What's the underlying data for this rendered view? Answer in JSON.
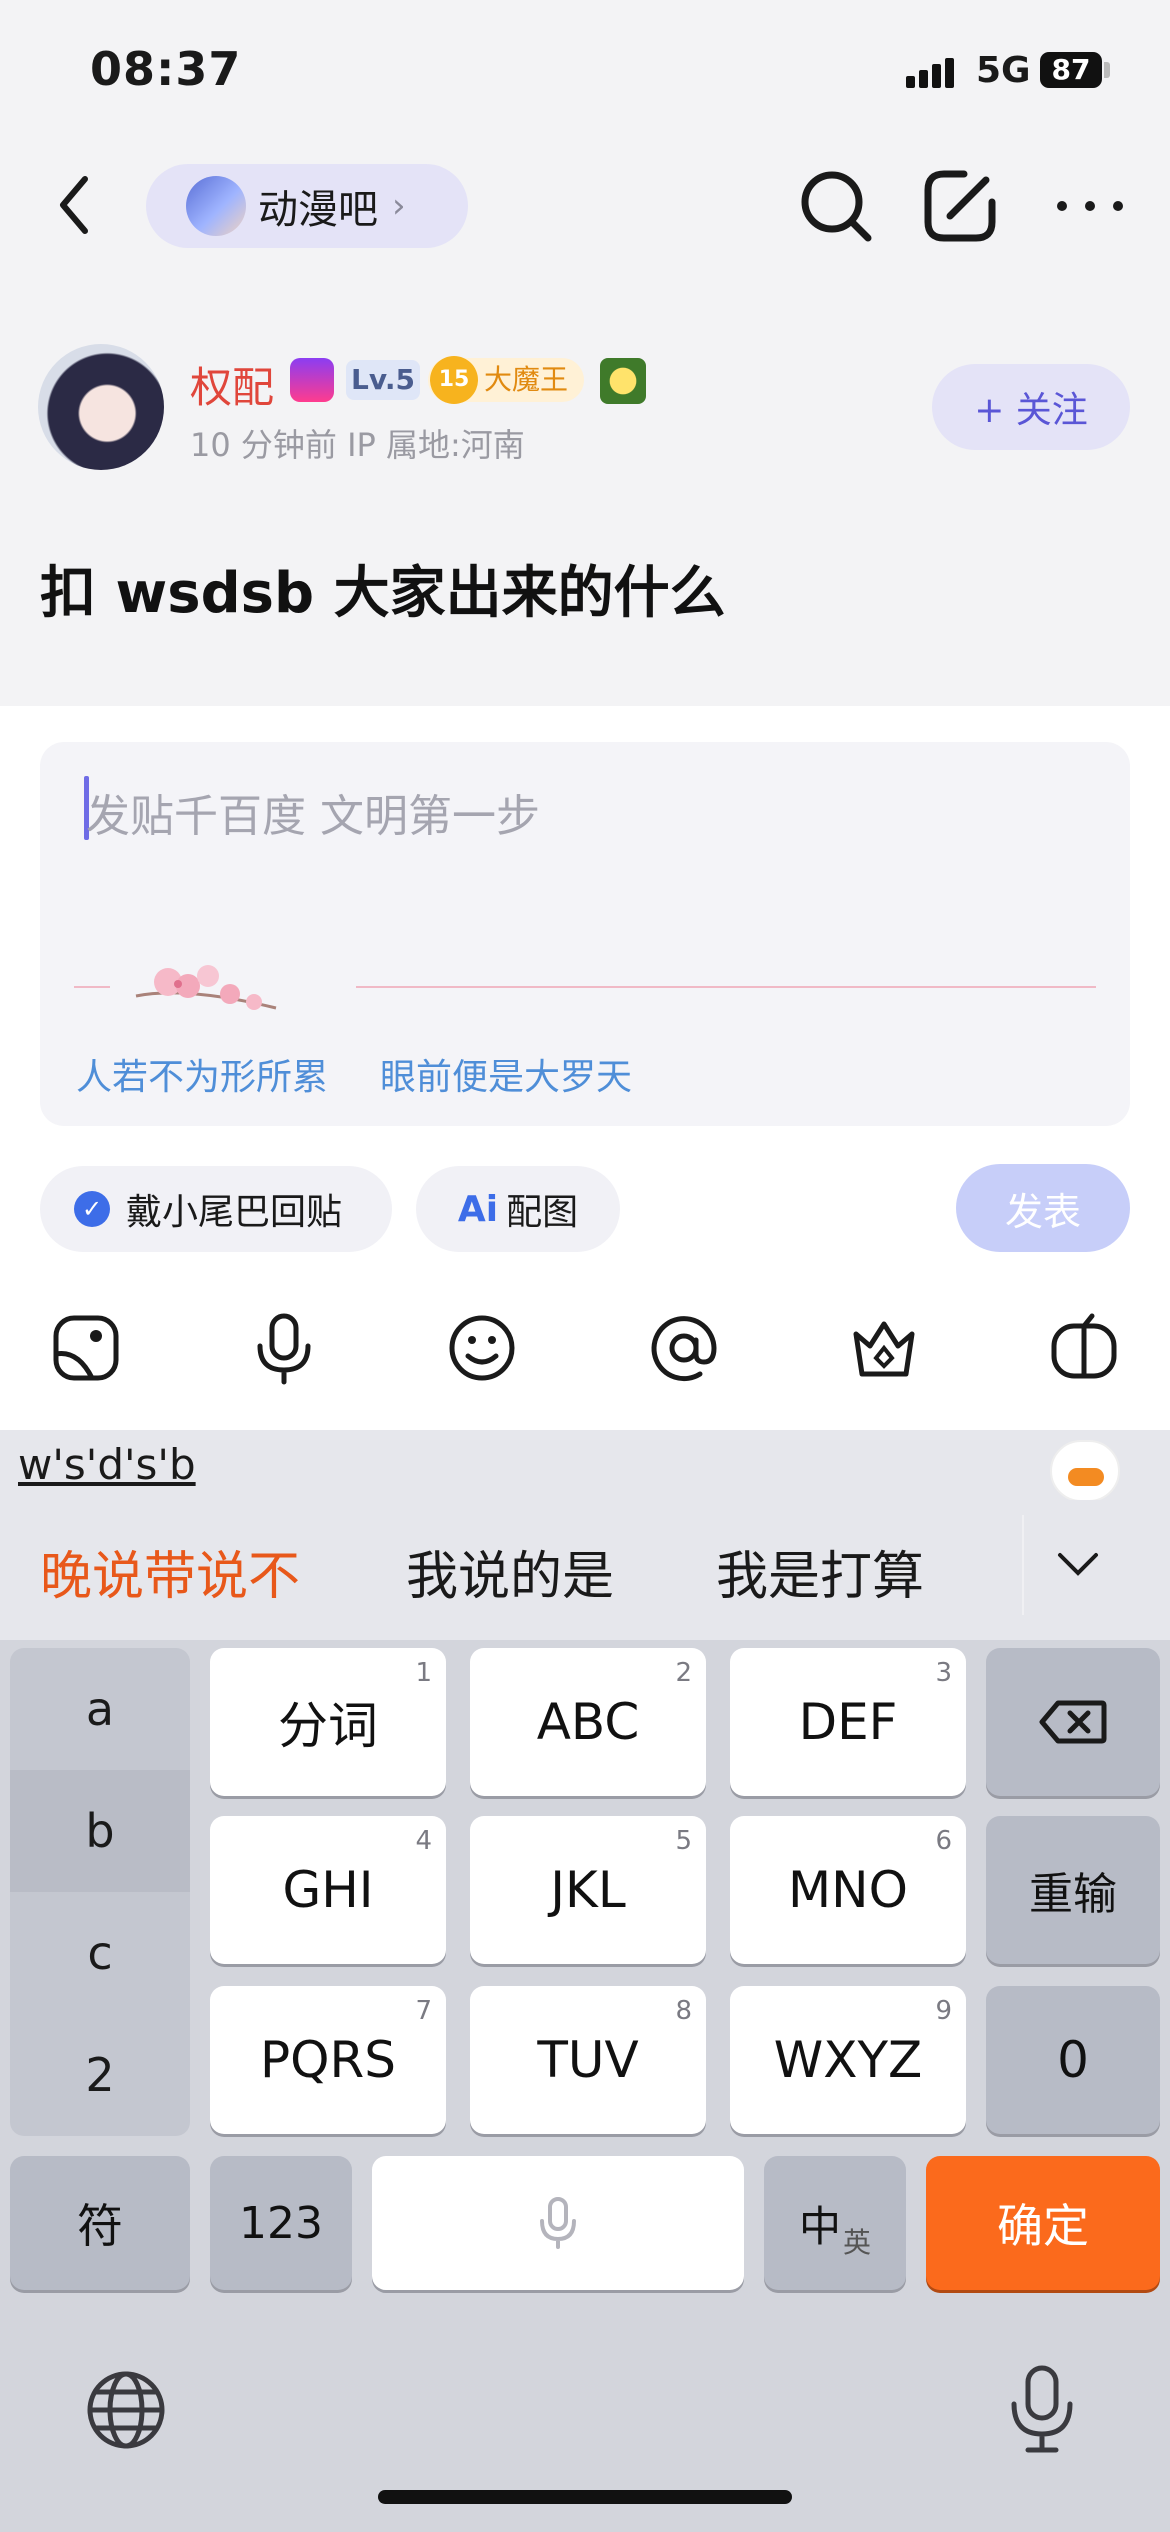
{
  "status_bar": {
    "time": "08:37",
    "network": "5G",
    "battery": "87"
  },
  "header": {
    "forum_name": "动漫吧",
    "icons": [
      "back-icon",
      "search-icon",
      "edit-icon",
      "more-icon"
    ]
  },
  "post": {
    "author": "权配",
    "level": "Lv.5",
    "rank_number": "15",
    "rank_title": "大魔王",
    "meta": "10 分钟前   IP 属地:河南",
    "follow_label": "+ 关注",
    "title": "扣 wsdsb 大家出来的什么"
  },
  "reply": {
    "placeholder": "发贴千百度 文明第一步",
    "tail_text_1": "人若不为形所累",
    "tail_text_2": "眼前便是大罗天",
    "tail_toggle_label": "戴小尾巴回贴",
    "image_button_label": "配图",
    "image_button_mark": "Ai",
    "publish_label": "发表",
    "toolbar_icons": [
      "sticker-icon",
      "microphone-icon",
      "emoji-icon",
      "mention-icon",
      "crown-icon",
      "gift-icon"
    ]
  },
  "keyboard": {
    "pinyin": "w's'd's'b",
    "candidates": [
      "晚说带说不",
      "我说的是",
      "我是打算"
    ],
    "side_column": [
      "a",
      "b",
      "c",
      "2"
    ],
    "keys": [
      {
        "label": "分词",
        "num": "1"
      },
      {
        "label": "ABC",
        "num": "2"
      },
      {
        "label": "DEF",
        "num": "3"
      },
      {
        "label": "GHI",
        "num": "4"
      },
      {
        "label": "JKL",
        "num": "5"
      },
      {
        "label": "MNO",
        "num": "6"
      },
      {
        "label": "PQRS",
        "num": "7"
      },
      {
        "label": "TUV",
        "num": "8"
      },
      {
        "label": "WXYZ",
        "num": "9"
      }
    ],
    "reset_label": "重输",
    "zero_label": "0",
    "symbol_label": "符",
    "numeric_label": "123",
    "lang_main": "中",
    "lang_alt": "英",
    "confirm_label": "确定",
    "colors": {
      "confirm": "#fb6a1c",
      "candidate_highlight": "#e8581a",
      "accent": "#5a56d6"
    }
  }
}
